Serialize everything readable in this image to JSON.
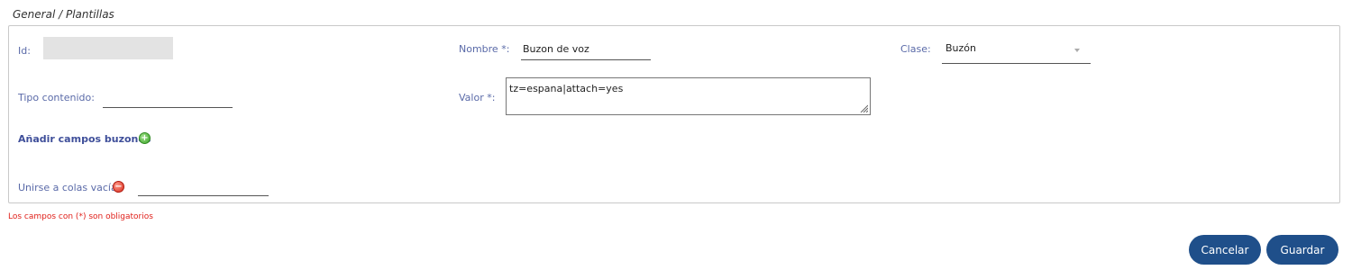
{
  "breadcrumb": "General / Plantillas",
  "form": {
    "id_label": "Id:",
    "id_value": "",
    "nombre_label": "Nombre *:",
    "nombre_value": "Buzon de voz",
    "clase_label": "Clase:",
    "clase_value": "Buzón",
    "tipo_label": "Tipo contenido:",
    "tipo_value": "",
    "valor_label": "Valor *:",
    "valor_value": "tz=espana|attach=yes",
    "add_fields_label": "Añadir campos buzones",
    "join_empty_label": "Unirse a colas vacías",
    "join_empty_value": ""
  },
  "required_note": "Los campos con (*) son obligatorios",
  "buttons": {
    "cancel": "Cancelar",
    "save": "Guardar"
  },
  "colors": {
    "label": "#5a6aa8",
    "button_bg": "#1f4f8a",
    "required_note": "#e0201a",
    "add_icon": "#3ea62a",
    "remove_icon": "#d82b1c"
  }
}
